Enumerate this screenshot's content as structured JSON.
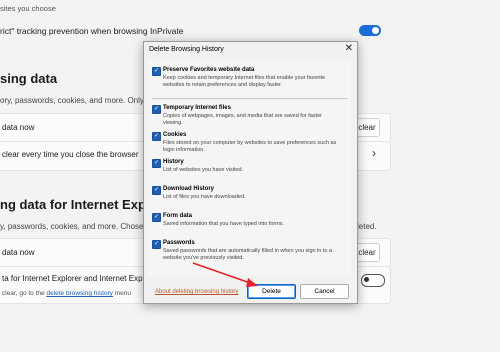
{
  "settings": {
    "frag_choose": "sites you choose",
    "strict_text": "rict\" tracking prevention when browsing InPrivate",
    "section1_title": "sing data",
    "section1_sub": "ory, passwords, cookies, and more. Only dat",
    "row1_label": "data now",
    "row1_button": "clear",
    "row2_label": "clear every time you close the browser",
    "section2_title": "ng data for Internet Explorer",
    "section2_sub": "y, passwords, cookies, and more. Chosen",
    "section2_sub_right": "leted.",
    "row3_label": "data now",
    "row3_button": "clear",
    "row4_label": "ta for Internet Explorer and Internet Exp",
    "row4_sub_prefix": "clear, go to the",
    "row4_link": "delete browsing history",
    "row4_sub_suffix": "menu"
  },
  "dialog": {
    "title": "Delete Browsing History",
    "close_glyph": "✕",
    "options": [
      {
        "title": "Preserve Favorites website data",
        "desc": "Keep cookies and temporary Internet files that enable your favorite websites to retain preferences and display faster.",
        "checked": true
      },
      {
        "title": "Temporary Internet files",
        "desc": "Copies of webpages, images, and media that are saved for faster viewing.",
        "checked": true
      },
      {
        "title": "Cookies",
        "desc": "Files stored on your computer by websites to save preferences such as login information.",
        "checked": true
      },
      {
        "title": "History",
        "desc": "List of websites you have visited.",
        "checked": true
      },
      {
        "title": "Download History",
        "desc": "List of files you have downloaded.",
        "checked": true
      },
      {
        "title": "Form data",
        "desc": "Saved information that you have typed into forms.",
        "checked": true
      },
      {
        "title": "Passwords",
        "desc": "Saved passwords that are automatically filled in when you sign in to a website you've previously visited.",
        "checked": true
      }
    ],
    "link": "About deleting browsing history",
    "delete_button": "Delete",
    "cancel_button": "Cancel"
  },
  "colors": {
    "accent": "#1a6dd8",
    "annotation_arrow": "#e8202a"
  },
  "icons": [
    "chevron-right-icon",
    "close-icon",
    "checkbox-icon",
    "arrow-annotation-icon"
  ]
}
